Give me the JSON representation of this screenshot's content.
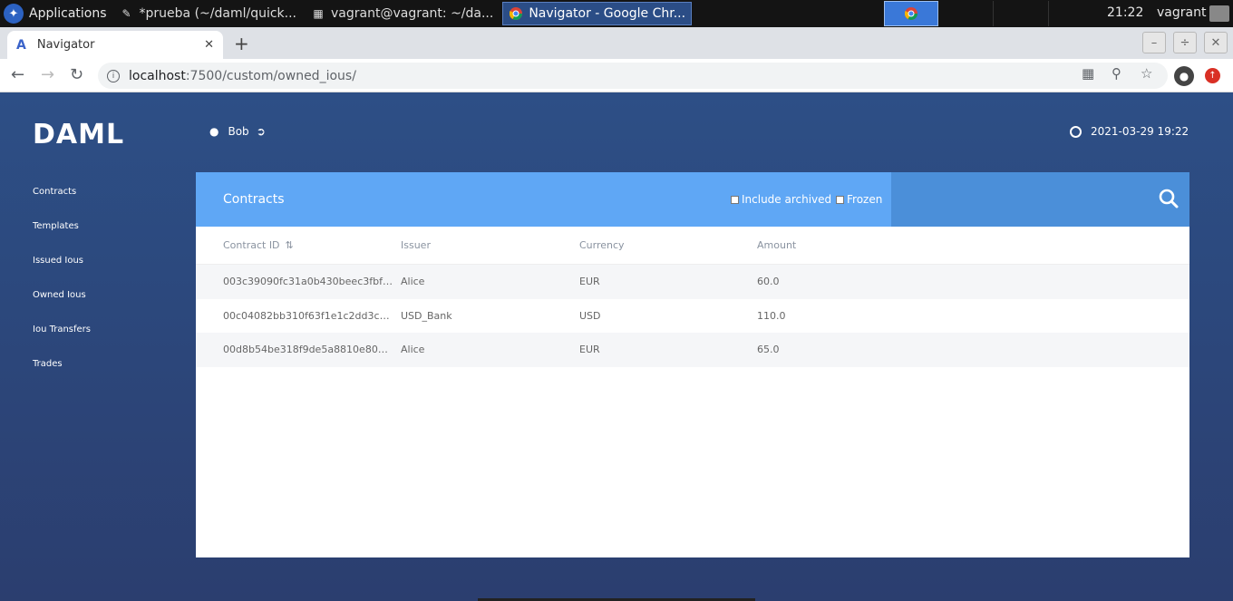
{
  "taskbar": {
    "apps_label": "Applications",
    "tasks": [
      {
        "label": "*prueba (~/daml/quick...",
        "active": false
      },
      {
        "label": "vagrant@vagrant: ~/da...",
        "active": false
      },
      {
        "label": "Navigator - Google Chr...",
        "active": true
      }
    ],
    "clock": "21:22",
    "user": "vagrant"
  },
  "browser": {
    "tab_title": "Navigator",
    "url_host": "localhost",
    "url_path": ":7500/custom/owned_ious/"
  },
  "app": {
    "brand": "DAML",
    "user_name": "Bob",
    "datetime": "2021-03-29 19:22",
    "nav": [
      "Contracts",
      "Templates",
      "Issued Ious",
      "Owned Ious",
      "Iou Transfers",
      "Trades"
    ],
    "panel": {
      "title": "Contracts",
      "include_archived_label": "Include archived",
      "frozen_label": "Frozen",
      "columns": [
        "Contract ID",
        "Issuer",
        "Currency",
        "Amount"
      ],
      "rows": [
        {
          "id": "003c39090fc31a0b430beec3fbfc...",
          "issuer": "Alice",
          "currency": "EUR",
          "amount": "60.0"
        },
        {
          "id": "00c04082bb310f63f1e1c2dd3ce6...",
          "issuer": "USD_Bank",
          "currency": "USD",
          "amount": "110.0"
        },
        {
          "id": "00d8b54be318f9de5a8810e8052...",
          "issuer": "Alice",
          "currency": "EUR",
          "amount": "65.0"
        }
      ]
    }
  },
  "colors": {
    "header_blue": "#5fa7f5",
    "search_blue": "#4b8fd9",
    "app_background": "#2c4a80"
  }
}
